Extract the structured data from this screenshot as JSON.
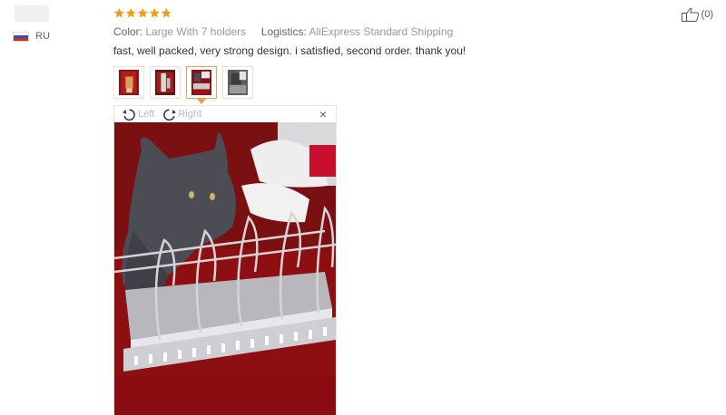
{
  "reviewer": {
    "country": "RU"
  },
  "review": {
    "rating": 5,
    "color_label": "Color:",
    "color_value": "Large With 7 holders",
    "logistics_label": "Logistics:",
    "logistics_value": "AliExpress Standard Shipping",
    "text": "fast, well packed, very strong design. i satisfied, second order. thank you!",
    "selected_thumbnail": 3
  },
  "viewer": {
    "rotate_left": "Left",
    "rotate_right": "Right",
    "close_symbol": "×"
  },
  "helpful": {
    "count": "(0)"
  },
  "colors": {
    "star": "#f39c12",
    "accent": "#f0a04b"
  }
}
